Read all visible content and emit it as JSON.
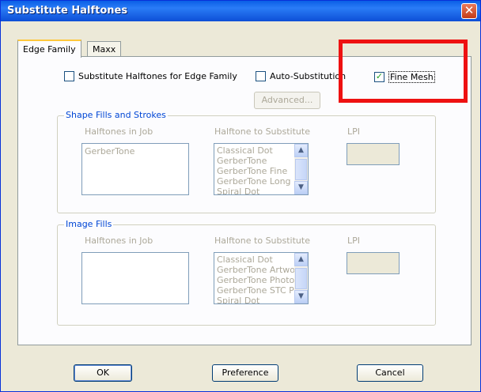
{
  "window": {
    "title": "Substitute Halftones",
    "close_glyph": "✕"
  },
  "tabs": [
    {
      "label": "Edge Family",
      "active": true
    },
    {
      "label": "Maxx",
      "active": false
    }
  ],
  "options": {
    "substitute": {
      "label": "Substitute Halftones for Edge Family",
      "checked": false
    },
    "auto": {
      "label": "Auto-Substitution",
      "checked": false
    },
    "fine_mesh": {
      "label": "Fine Mesh",
      "checked": true
    }
  },
  "advanced_button": "Advanced...",
  "shape_group": {
    "legend": "Shape Fills and Strokes",
    "col_job": "Halftones in Job",
    "col_sub": "Halftone to Substitute",
    "col_lpi": "LPI",
    "job_items": [
      "GerberTone"
    ],
    "sub_items": [
      "Classical Dot",
      "GerberTone",
      "GerberTone Fine",
      "GerberTone Long",
      "Spiral Dot"
    ]
  },
  "image_group": {
    "legend": "Image Fills",
    "col_job": "Halftones in Job",
    "col_sub": "Halftone to Substitute",
    "col_lpi": "LPI",
    "job_items": [],
    "sub_items": [
      "Classical Dot",
      "GerberTone Artwork",
      "GerberTone Photo",
      "GerberTone STC Ph",
      "Spiral Dot"
    ]
  },
  "buttons": {
    "ok": "OK",
    "preference": "Preference",
    "cancel": "Cancel"
  },
  "colors": {
    "highlight": "#ee1111",
    "titlebar": "#0a5ee6",
    "dialog_bg": "#ece9d8"
  }
}
